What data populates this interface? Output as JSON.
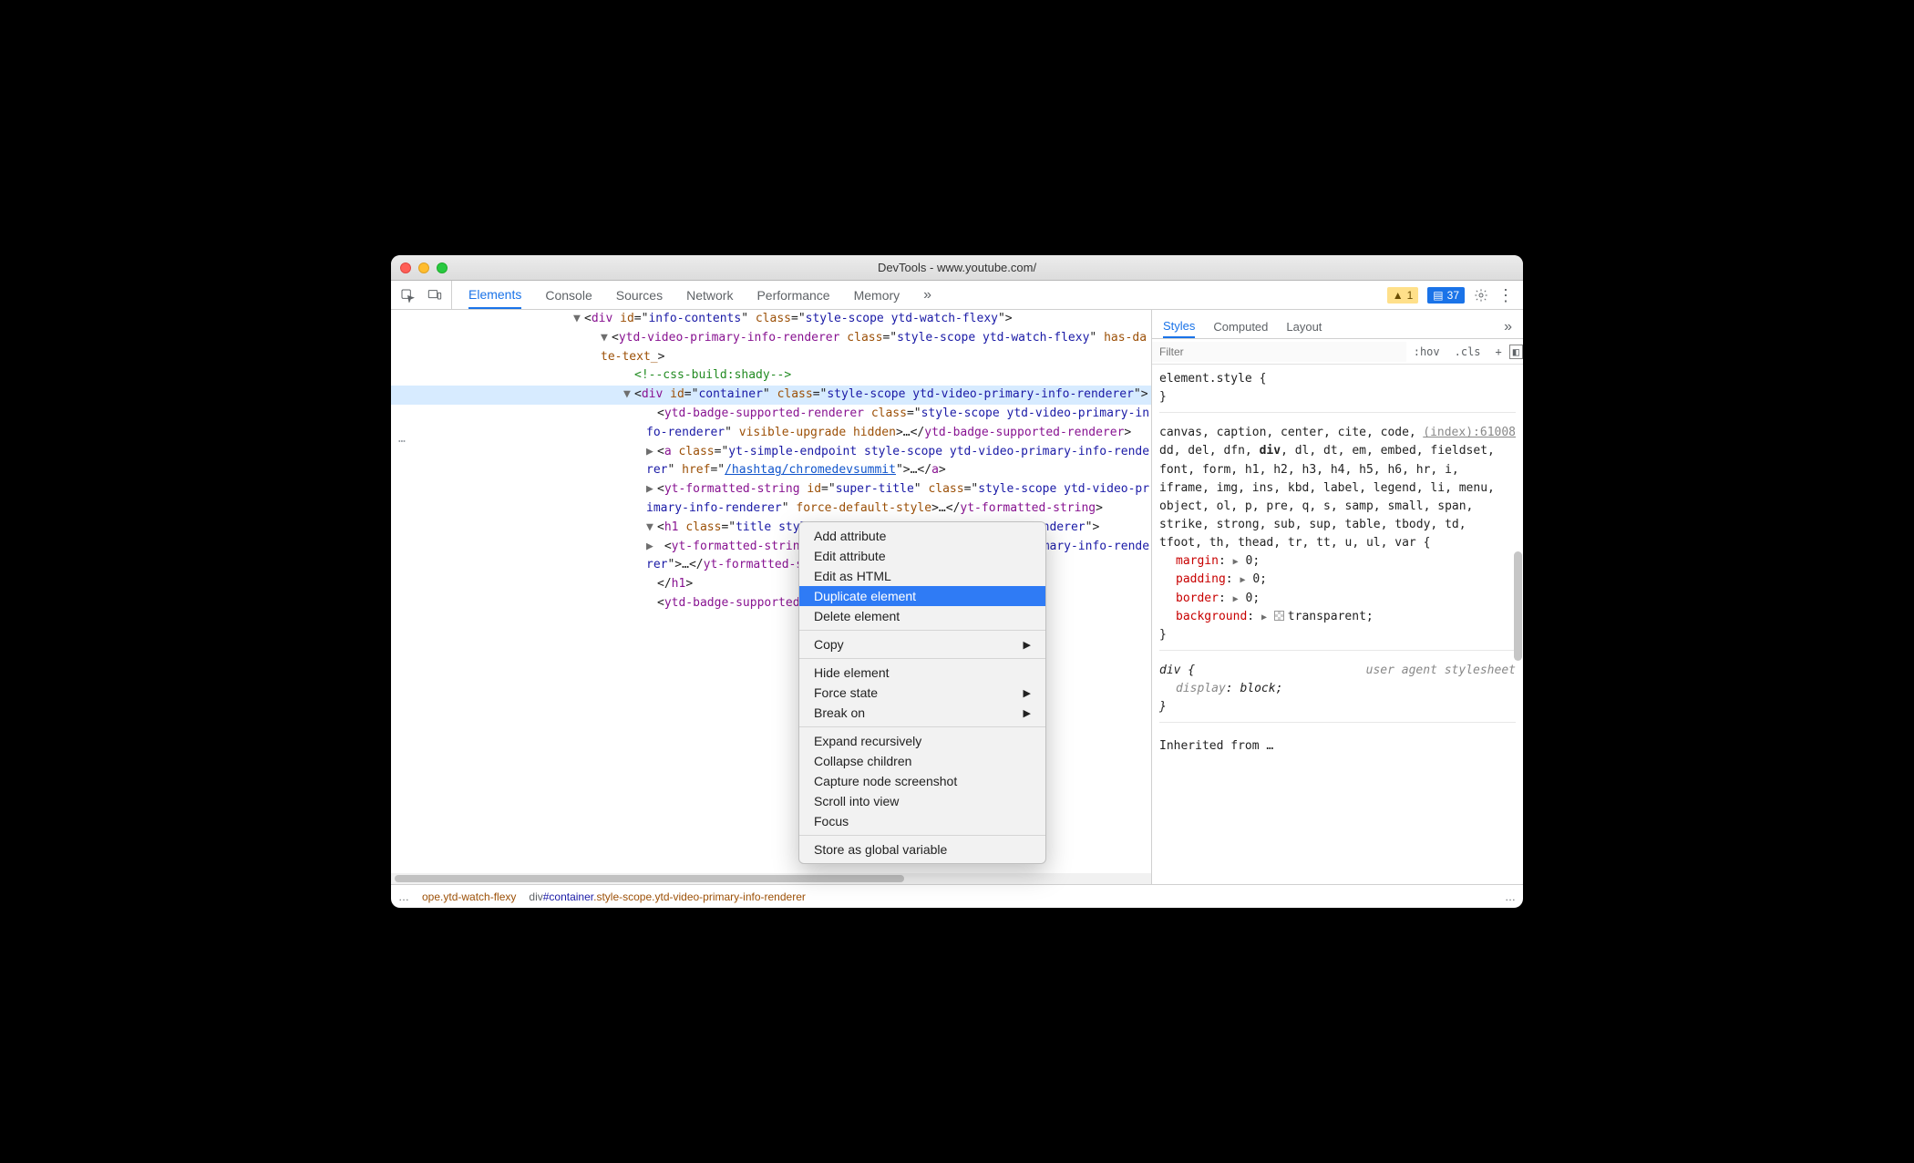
{
  "window": {
    "title": "DevTools - www.youtube.com/"
  },
  "toolbar": {
    "tabs": [
      "Elements",
      "Console",
      "Sources",
      "Network",
      "Performance",
      "Memory"
    ],
    "active_tab": 0,
    "warning_count": "1",
    "message_count": "37"
  },
  "elements": {
    "gutter": "…",
    "lines": [
      {
        "indent": 1,
        "selected": false,
        "tri": "▼",
        "html": "<<t>div</t> <a>id</a>=\"<v>info-contents</v>\" <a>class</a>=\"<v>style-scope ytd-watch-flexy</v>\">"
      },
      {
        "indent": 2,
        "selected": false,
        "tri": "▼",
        "html": "<<t>ytd-video-primary-info-renderer</t> <a>class</a>=\"<v>style-scope ytd-watch-flexy</v>\" <a>has-date-text_</a>>"
      },
      {
        "indent": 3,
        "selected": false,
        "tri": "",
        "html": "<c><!--css-build:shady--></c>"
      },
      {
        "indent": 3,
        "selected": true,
        "tri": "▼",
        "html": "<<t>div</t> <a>id</a>=\"<v>container</v>\" <a>class</a>=\"<v>style-scope ytd-video-primary-info-renderer</v>\">"
      },
      {
        "indent": 4,
        "selected": false,
        "tri": "",
        "html": "<<t>ytd-badge-supported-renderer</t> <a>class</a>=\"<v>style-scope ytd-video-primary-info-renderer</v>\" <a>visible-upgrade</a> <a>hidden</a>>…</<t>ytd-badge-supported-renderer</t>>"
      },
      {
        "indent": 4,
        "selected": false,
        "tri": "▶",
        "html": "<<t>a</t> <a>class</a>=\"<v>yt-simple-endpoint style-scope ytd-video-primary-info-renderer</v>\" <a>href</a>=\"<l>/hashtag/chromedevsummit</l>\">…</<t>a</t>>"
      },
      {
        "indent": 4,
        "selected": false,
        "tri": "▶",
        "html": "<<t>yt-formatted-string</t> <a>id</a>=\"<v>super-title</v>\" <a>class</a>=\"<v>style-scope ytd-video-primary-info-renderer</v>\" <a>force-default-style</a>>…</<t>yt-formatted-string</t>>"
      },
      {
        "indent": 4,
        "selected": false,
        "tri": "▼",
        "html": "<<t>h1</t> <a>class</a>=\"<v>title style-scope ytd-video-primary-info-renderer</v>\">"
      },
      {
        "indent": 4,
        "selected": false,
        "tri": "▶",
        "html": " <<t>yt-formatted-string</t> <a>class</a>=\"<v>style-scope ytd-video-primary-info-renderer</v>\">…</<t>yt-formatted-string</t>>"
      },
      {
        "indent": 4,
        "selected": false,
        "tri": "",
        "html": "</<t>h1</t>>"
      },
      {
        "indent": 4,
        "selected": false,
        "tri": "",
        "html": "<<t>ytd-badge-supported-renderer</t> <a>class</a>=\"<v>style-scop</v>"
      }
    ]
  },
  "breadcrumb": {
    "left_overflow": "…",
    "items": [
      {
        "text": "ope.ytd-watch-flexy",
        "type": "cls"
      },
      {
        "text": "div#container.style-scope.ytd-video-primary-info-renderer",
        "type": "sel"
      }
    ],
    "right_overflow": "…"
  },
  "context_menu": {
    "groups": [
      [
        "Add attribute",
        "Edit attribute",
        "Edit as HTML",
        "Duplicate element",
        "Delete element"
      ],
      [
        {
          "label": "Copy",
          "submenu": true
        }
      ],
      [
        "Hide element",
        {
          "label": "Force state",
          "submenu": true
        },
        {
          "label": "Break on",
          "submenu": true
        }
      ],
      [
        "Expand recursively",
        "Collapse children",
        "Capture node screenshot",
        "Scroll into view",
        "Focus"
      ],
      [
        "Store as global variable"
      ]
    ],
    "highlighted": "Duplicate element"
  },
  "styles": {
    "tabs": [
      "Styles",
      "Computed",
      "Layout"
    ],
    "active_tab": 0,
    "filter_placeholder": "Filter",
    "hov": ":hov",
    "cls": ".cls",
    "plus": "+",
    "element_style_header": "element.style {",
    "element_style_close": "}",
    "sel_source": "(index):61008",
    "sel_list": "canvas, caption, center, cite, code, dd, del, dfn, div, dl, dt, em, embed, fieldset, font, form, h1, h2, h3, h4, h5, h6, hr, i, iframe, img, ins, kbd, label, legend, li, menu, object, ol, p, pre, q, s, samp, small, span, strike, strong, sub, sup, table, tbody, td, tfoot, th, thead, tr, tt, u, ul, var {",
    "decls": [
      {
        "prop": "margin",
        "val": "0"
      },
      {
        "prop": "padding",
        "val": "0"
      },
      {
        "prop": "border",
        "val": "0"
      },
      {
        "prop": "background",
        "val": "transparent",
        "swatch": true
      }
    ],
    "close_brace": "}",
    "ua_header": "div {",
    "ua_note": "user agent stylesheet",
    "ua_decl_prop": "display",
    "ua_decl_val": "block",
    "inherited": "Inherited from …"
  }
}
